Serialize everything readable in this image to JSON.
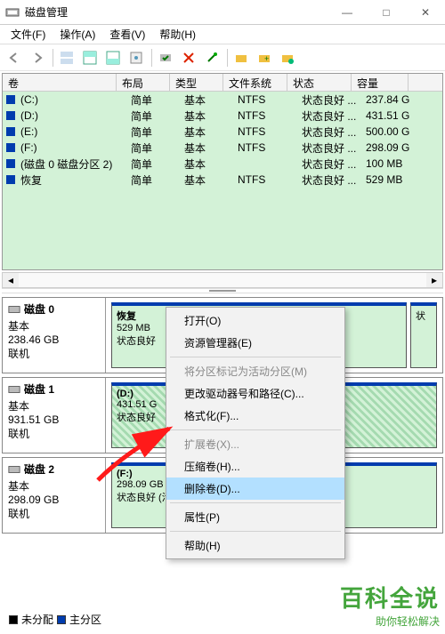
{
  "window": {
    "title": "磁盘管理"
  },
  "winbtns": {
    "min": "—",
    "max": "□",
    "close": "✕"
  },
  "menu": {
    "file": "文件(F)",
    "action": "操作(A)",
    "view": "查看(V)",
    "help": "帮助(H)"
  },
  "columns": {
    "vol": "卷",
    "layout": "布局",
    "type": "类型",
    "fs": "文件系统",
    "status": "状态",
    "cap": "容量"
  },
  "volumes": [
    {
      "name": "(C:)",
      "layout": "简单",
      "type": "基本",
      "fs": "NTFS",
      "status": "状态良好 ...",
      "cap": "237.84 G"
    },
    {
      "name": "(D:)",
      "layout": "简单",
      "type": "基本",
      "fs": "NTFS",
      "status": "状态良好 ...",
      "cap": "431.51 G"
    },
    {
      "name": "(E:)",
      "layout": "简单",
      "type": "基本",
      "fs": "NTFS",
      "status": "状态良好 ...",
      "cap": "500.00 G"
    },
    {
      "name": "(F:)",
      "layout": "简单",
      "type": "基本",
      "fs": "NTFS",
      "status": "状态良好 ...",
      "cap": "298.09 G"
    },
    {
      "name": "(磁盘 0 磁盘分区 2)",
      "layout": "简单",
      "type": "基本",
      "fs": "",
      "status": "状态良好 ...",
      "cap": "100 MB"
    },
    {
      "name": "恢复",
      "layout": "简单",
      "type": "基本",
      "fs": "NTFS",
      "status": "状态良好 ...",
      "cap": "529 MB"
    }
  ],
  "disks": [
    {
      "name": "磁盘 0",
      "type": "基本",
      "size": "238.46 GB",
      "status": "联机",
      "parts": [
        {
          "label": "恢复",
          "size": "529 MB",
          "status": "状态良好"
        },
        {
          "label": "",
          "size": "状",
          "status": ""
        }
      ]
    },
    {
      "name": "磁盘 1",
      "type": "基本",
      "size": "931.51 GB",
      "status": "联机",
      "parts": [
        {
          "label": "(D:)",
          "size": "431.51 G",
          "status": "状态良好"
        }
      ]
    },
    {
      "name": "磁盘 2",
      "type": "基本",
      "size": "298.09 GB",
      "status": "联机",
      "parts": [
        {
          "label": "(F:)",
          "size": "298.09 GB NTFS",
          "status": "状态良好 (活动, 主分区)"
        }
      ]
    }
  ],
  "ctx": {
    "open": "打开(O)",
    "explorer": "资源管理器(E)",
    "markactive": "将分区标记为活动分区(M)",
    "changepath": "更改驱动器号和路径(C)...",
    "format": "格式化(F)...",
    "extend": "扩展卷(X)...",
    "shrink": "压缩卷(H)...",
    "delete": "删除卷(D)...",
    "props": "属性(P)",
    "help": "帮助(H)"
  },
  "legend": {
    "unalloc": "未分配",
    "primary": "主分区"
  },
  "watermark": {
    "big": "百科全说",
    "sm": "助你轻松解决"
  }
}
